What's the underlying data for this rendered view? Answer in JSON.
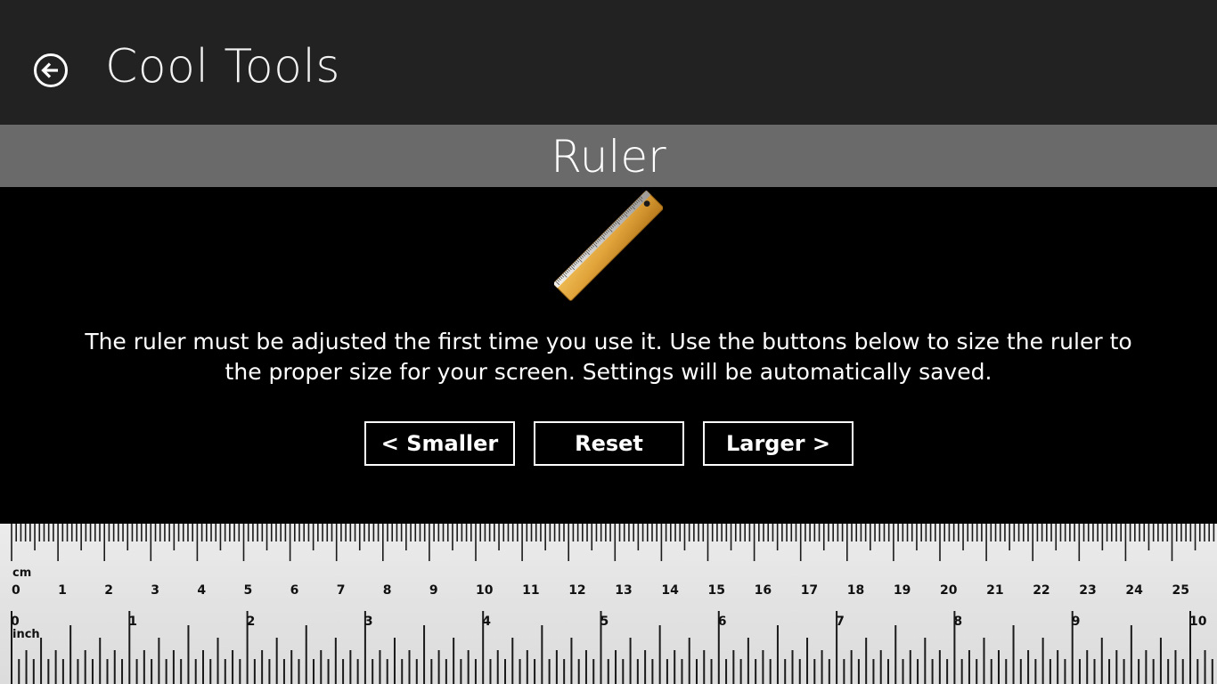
{
  "header": {
    "back_icon": "back-arrow-icon",
    "title": "Cool Tools"
  },
  "section": {
    "title": "Ruler"
  },
  "illustration": {
    "icon": "ruler-icon"
  },
  "instructions": {
    "text": "The ruler must be adjusted the first time you use it. Use the buttons below to size the ruler to the proper size for your screen. Settings will be automatically saved."
  },
  "buttons": {
    "smaller": "< Smaller",
    "reset": "Reset",
    "larger": "Larger >"
  },
  "ruler": {
    "cm_unit_label": "cm",
    "inch_unit_label": "inch",
    "cm_numbers": [
      "0",
      "1",
      "2",
      "3",
      "4",
      "5",
      "6",
      "7",
      "8",
      "9",
      "10",
      "11",
      "12",
      "13",
      "14",
      "15",
      "16",
      "17",
      "18",
      "19",
      "20",
      "21",
      "22",
      "23",
      "24",
      "25"
    ],
    "inch_numbers": [
      "0",
      "1",
      "2",
      "3",
      "4",
      "5",
      "6",
      "7",
      "8",
      "9",
      "10"
    ]
  },
  "colors": {
    "header_bg": "#222222",
    "section_band": "#6a6a6a",
    "ruler_face": "#e4e4e4",
    "ruler_wood": "#e0a33a"
  }
}
